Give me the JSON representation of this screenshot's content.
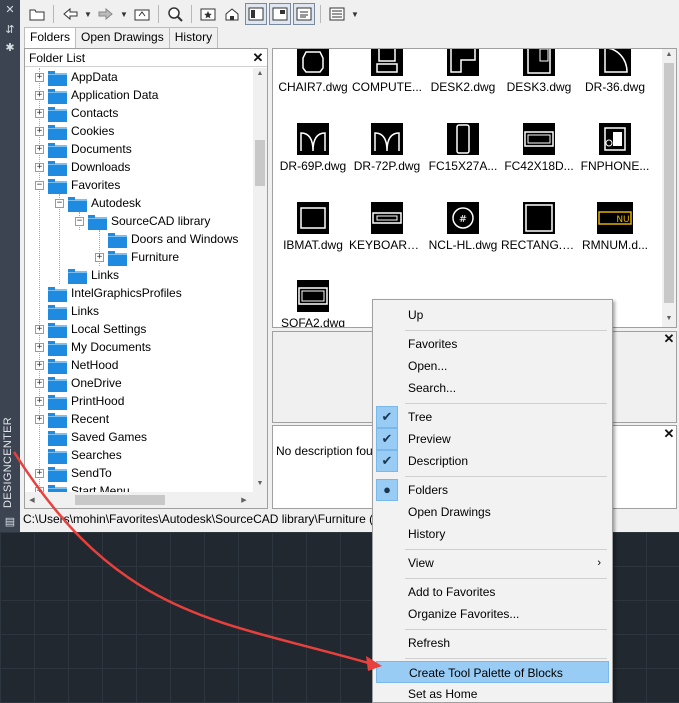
{
  "side": {
    "vertical_title": "DESIGNCENTER"
  },
  "tabs": [
    {
      "label": "Folders"
    },
    {
      "label": "Open Drawings"
    },
    {
      "label": "History"
    }
  ],
  "folder_list": {
    "header": "Folder List",
    "items": [
      {
        "label": "AppData"
      },
      {
        "label": "Application Data"
      },
      {
        "label": "Contacts"
      },
      {
        "label": "Cookies"
      },
      {
        "label": "Documents"
      },
      {
        "label": "Downloads"
      },
      {
        "label": "Favorites"
      },
      {
        "label": "Autodesk"
      },
      {
        "label": "SourceCAD library"
      },
      {
        "label": "Doors and Windows"
      },
      {
        "label": "Furniture"
      },
      {
        "label": "Links"
      },
      {
        "label": "IntelGraphicsProfiles"
      },
      {
        "label": "Links"
      },
      {
        "label": "Local Settings"
      },
      {
        "label": "My Documents"
      },
      {
        "label": "NetHood"
      },
      {
        "label": "OneDrive"
      },
      {
        "label": "PrintHood"
      },
      {
        "label": "Recent"
      },
      {
        "label": "Saved Games"
      },
      {
        "label": "Searches"
      },
      {
        "label": "SendTo"
      },
      {
        "label": "Start Menu"
      }
    ]
  },
  "content": {
    "items": [
      {
        "label": "CHAIR7.dwg"
      },
      {
        "label": "COMPUTE..."
      },
      {
        "label": "DESK2.dwg"
      },
      {
        "label": "DESK3.dwg"
      },
      {
        "label": "DR-36.dwg"
      },
      {
        "label": "DR-69P.dwg"
      },
      {
        "label": "DR-72P.dwg"
      },
      {
        "label": "FC15X27A..."
      },
      {
        "label": "FC42X18D..."
      },
      {
        "label": "FNPHONE..."
      },
      {
        "label": "IBMAT.dwg"
      },
      {
        "label": "KEYBOARD..."
      },
      {
        "label": "NCL-HL.dwg"
      },
      {
        "label": "RECTANG.d..."
      },
      {
        "label": "RMNUM.d..."
      },
      {
        "label": "SOFA2.dwg"
      }
    ],
    "rmnum_text": "NU"
  },
  "description": {
    "text": "No description fou"
  },
  "status_path": "C:\\Users\\mohin\\Favorites\\Autodesk\\SourceCAD library\\Furniture (",
  "context_menu": {
    "up": "Up",
    "favorites": "Favorites",
    "open": "Open...",
    "search": "Search...",
    "tree": "Tree",
    "preview": "Preview",
    "description": "Description",
    "folders": "Folders",
    "open_drawings": "Open Drawings",
    "history": "History",
    "view": "View",
    "add_to_favorites": "Add to Favorites",
    "organize_favorites": "Organize Favorites...",
    "refresh": "Refresh",
    "create_tool_palette": "Create Tool Palette of Blocks",
    "set_as_home": "Set as Home"
  },
  "colors": {
    "arrow": "#e8403c",
    "highlight": "#99ccf4",
    "folder": "#1e8ae0"
  }
}
